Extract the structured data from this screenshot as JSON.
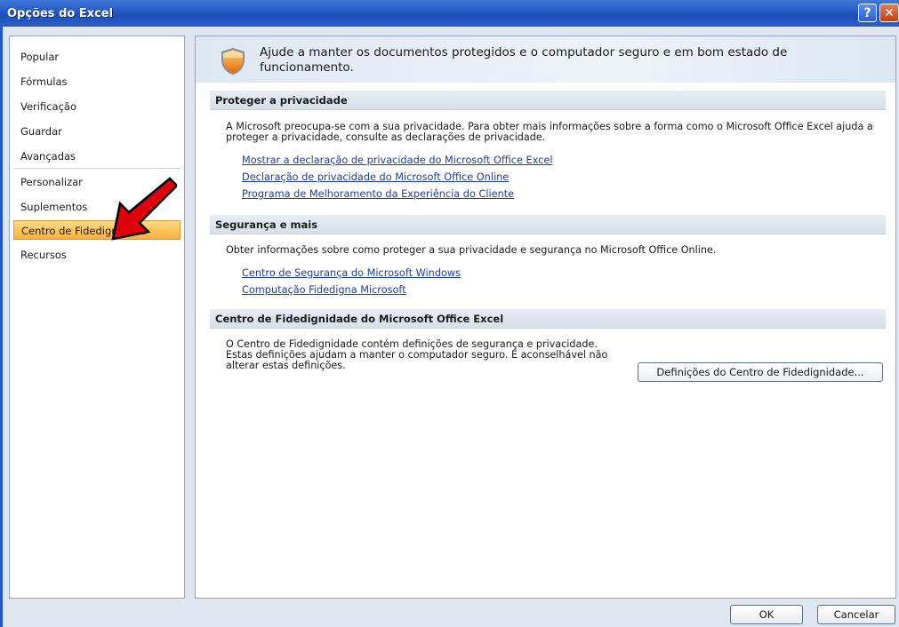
{
  "window": {
    "title": "Opções do Excel",
    "help_glyph": "?",
    "close_glyph": "✕"
  },
  "sidebar": {
    "items": [
      {
        "label": "Popular"
      },
      {
        "label": "Fórmulas"
      },
      {
        "label": "Verificação"
      },
      {
        "label": "Guardar"
      },
      {
        "label": "Avançadas"
      },
      {
        "label": "Personalizar"
      },
      {
        "label": "Suplementos"
      },
      {
        "label": "Centro de Fidedignidade"
      },
      {
        "label": "Recursos"
      }
    ],
    "selected": "Centro de Fidedignidade"
  },
  "banner": {
    "text": "Ajude a manter os documentos protegidos e o computador seguro e em bom estado de funcionamento.",
    "icon": "shield-icon"
  },
  "sections": {
    "privacy": {
      "heading": "Proteger a privacidade",
      "body": "A Microsoft preocupa-se com a sua privacidade. Para obter mais informações sobre a forma como o Microsoft Office Excel ajuda a proteger a privacidade, consulte as declarações de privacidade.",
      "links": [
        "Mostrar a declaração de privacidade do Microsoft Office Excel",
        "Declaração de privacidade do Microsoft Office Online",
        "Programa de Melhoramento da Experiência do Cliente"
      ]
    },
    "security": {
      "heading": "Segurança e mais",
      "body": "Obter informações sobre como proteger a sua privacidade e segurança no Microsoft Office Online.",
      "links": [
        "Centro de Segurança do Microsoft Windows",
        "Computação Fidedigna Microsoft"
      ]
    },
    "trust_center": {
      "heading": "Centro de Fidedignidade do Microsoft Office Excel",
      "body": "O Centro de Fidedignidade contém definições de segurança e privacidade. Estas definições ajudam a manter o computador seguro. É aconselhável não alterar estas definições.",
      "button_label": "Definições do Centro de Fidedignidade..."
    }
  },
  "footer": {
    "ok_label": "OK",
    "cancel_label": "Cancelar"
  },
  "colors": {
    "titlebar": "#2457c4",
    "selected_item": "#ffc55a",
    "link": "#1c3fa0",
    "arrow": "#e0000b"
  }
}
